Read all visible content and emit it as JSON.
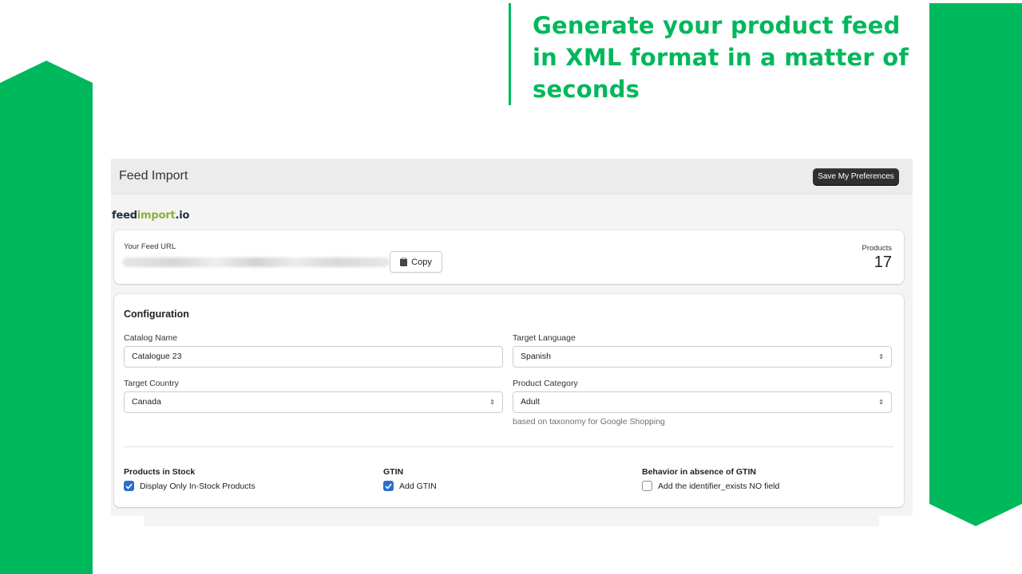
{
  "colors": {
    "brand_green": "#00b85c",
    "logo_dark": "#1f2d3d",
    "logo_green": "#86b33a",
    "checkbox_blue": "#2c6ecb"
  },
  "headline": "Generate your product feed in XML format in a matter of seconds",
  "app": {
    "title": "Feed Import",
    "save_button": "Save My Preferences",
    "logo": {
      "part1": "feed",
      "part2": "import",
      "part3": ".io"
    }
  },
  "feed_url": {
    "label": "Your Feed URL",
    "copy_button": "Copy",
    "products_label": "Products",
    "products_count": "17"
  },
  "configuration": {
    "title": "Configuration",
    "catalog_name": {
      "label": "Catalog Name",
      "value": "Catalogue 23"
    },
    "target_language": {
      "label": "Target Language",
      "value": "Spanish"
    },
    "target_country": {
      "label": "Target Country",
      "value": "Canada"
    },
    "product_category": {
      "label": "Product Category",
      "value": "Adult",
      "helper": "based on taxonomy for Google Shopping"
    },
    "stock": {
      "title": "Products in Stock",
      "option": "Display Only In-Stock Products",
      "checked": true
    },
    "gtin": {
      "title": "GTIN",
      "option": "Add GTIN",
      "checked": true
    },
    "gtin_absence": {
      "title": "Behavior in absence of GTIN",
      "option": "Add the identifier_exists NO field",
      "checked": false
    }
  }
}
